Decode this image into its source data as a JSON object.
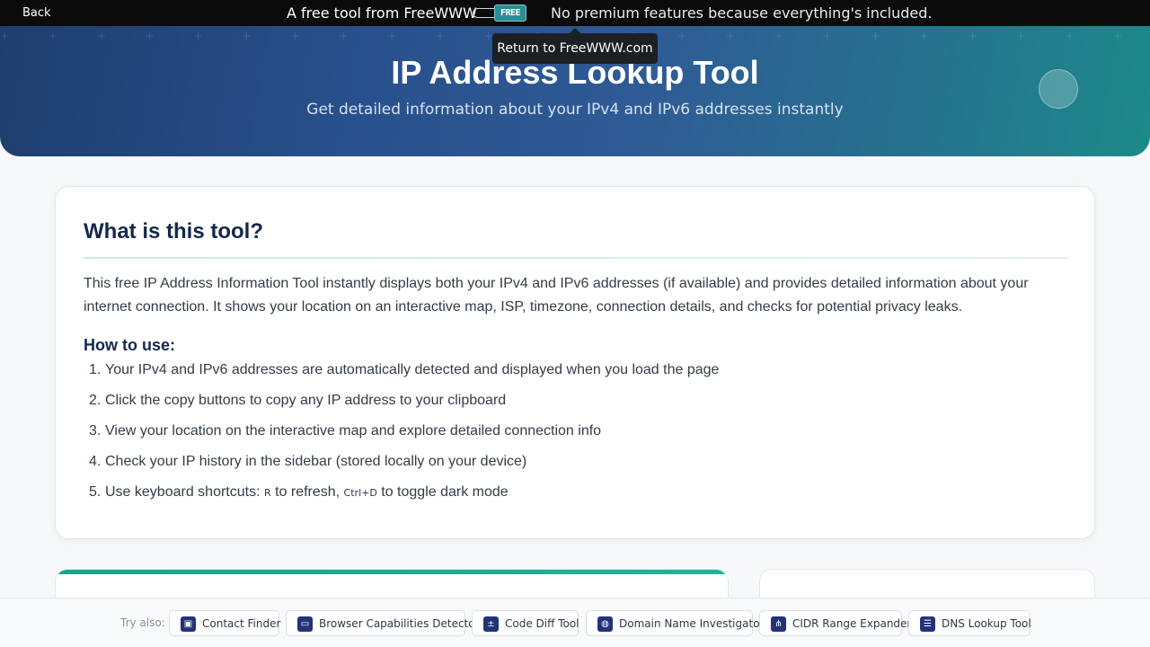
{
  "topbar": {
    "back_label": "Back",
    "free_text": "A free tool from FreeWWW",
    "logo_text": "FREE",
    "no_premium_text": "No premium features because everything's included."
  },
  "tooltip": {
    "text": "Return to FreeWWW.com"
  },
  "hero": {
    "title": "IP Address Lookup Tool",
    "subtitle": "Get detailed information about your IPv4 and IPv6 addresses instantly"
  },
  "info_card": {
    "heading": "What is this tool?",
    "description": "This free IP Address Information Tool instantly displays both your IPv4 and IPv6 addresses (if available) and provides detailed information about your internet connection. It shows your location on an interactive map, ISP, timezone, connection details, and checks for potential privacy leaks.",
    "how_to_heading": "How to use:",
    "steps": [
      "Your IPv4 and IPv6 addresses are automatically detected and displayed when you load the page",
      "Click the copy buttons to copy any IP address to your clipboard",
      "View your location on the interactive map and explore detailed connection info",
      "Check your IP history in the sidebar (stored locally on your device)"
    ],
    "step5_prefix": "Use keyboard shortcuts: ",
    "step5_key1": "R",
    "step5_middle": " to refresh, ",
    "step5_key2": "Ctrl+D",
    "step5_suffix": " to toggle dark mode"
  },
  "try_also": {
    "label": "Try also:",
    "tools": [
      {
        "label": "Contact Finder",
        "icon": "contact-icon"
      },
      {
        "label": "Browser Capabilities Detector",
        "icon": "browser-icon"
      },
      {
        "label": "Code Diff Tool",
        "icon": "diff-icon"
      },
      {
        "label": "Domain Name Investigator",
        "icon": "globe-icon"
      },
      {
        "label": "CIDR Range Expander",
        "icon": "network-icon"
      },
      {
        "label": "DNS Lookup Tool",
        "icon": "server-icon"
      }
    ]
  },
  "colors": {
    "hero_start": "#1e3e6e",
    "hero_end": "#1c8a8a",
    "heading": "#14284b",
    "accent_green": "#1aa38a",
    "tool_icon_bg": "#23337a"
  }
}
